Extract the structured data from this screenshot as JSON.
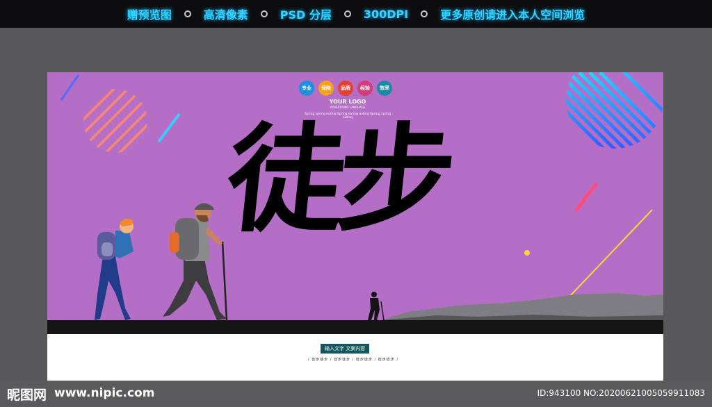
{
  "topbar": {
    "items": [
      {
        "label": "赠预览图"
      },
      {
        "label": "高清像素"
      },
      {
        "label": "PSD 分层"
      },
      {
        "label": "300DPI"
      },
      {
        "label": "更多原创请进入本人空间浏览"
      }
    ]
  },
  "poster": {
    "badges": [
      {
        "label": "专业",
        "color": "#1e8fe0"
      },
      {
        "label": "保险",
        "color": "#f5a11b"
      },
      {
        "label": "品牌",
        "color": "#e5412e"
      },
      {
        "label": "经验",
        "color": "#d33c78"
      },
      {
        "label": "效率",
        "color": "#1a8aaa"
      }
    ],
    "logo_title": "YOUR LOGO",
    "logo_sub": "ADVERTISING LANGUAGE",
    "slogans": "Spring spring outing   Spring spring outing   Spring spring outing",
    "title": "徒步",
    "caption": "输入文字 文案内容",
    "caption_small": "/ 徒步徒步 / 徒步徒步 / 徒步徒步 / 徒步徒步 /",
    "colors": {
      "background": "#b46ec6",
      "ground": "#141414"
    }
  },
  "footer": {
    "brand": "昵图网",
    "url": "www.nipic.com",
    "id_text": "ID:943100 NO:20200621005059911083"
  }
}
